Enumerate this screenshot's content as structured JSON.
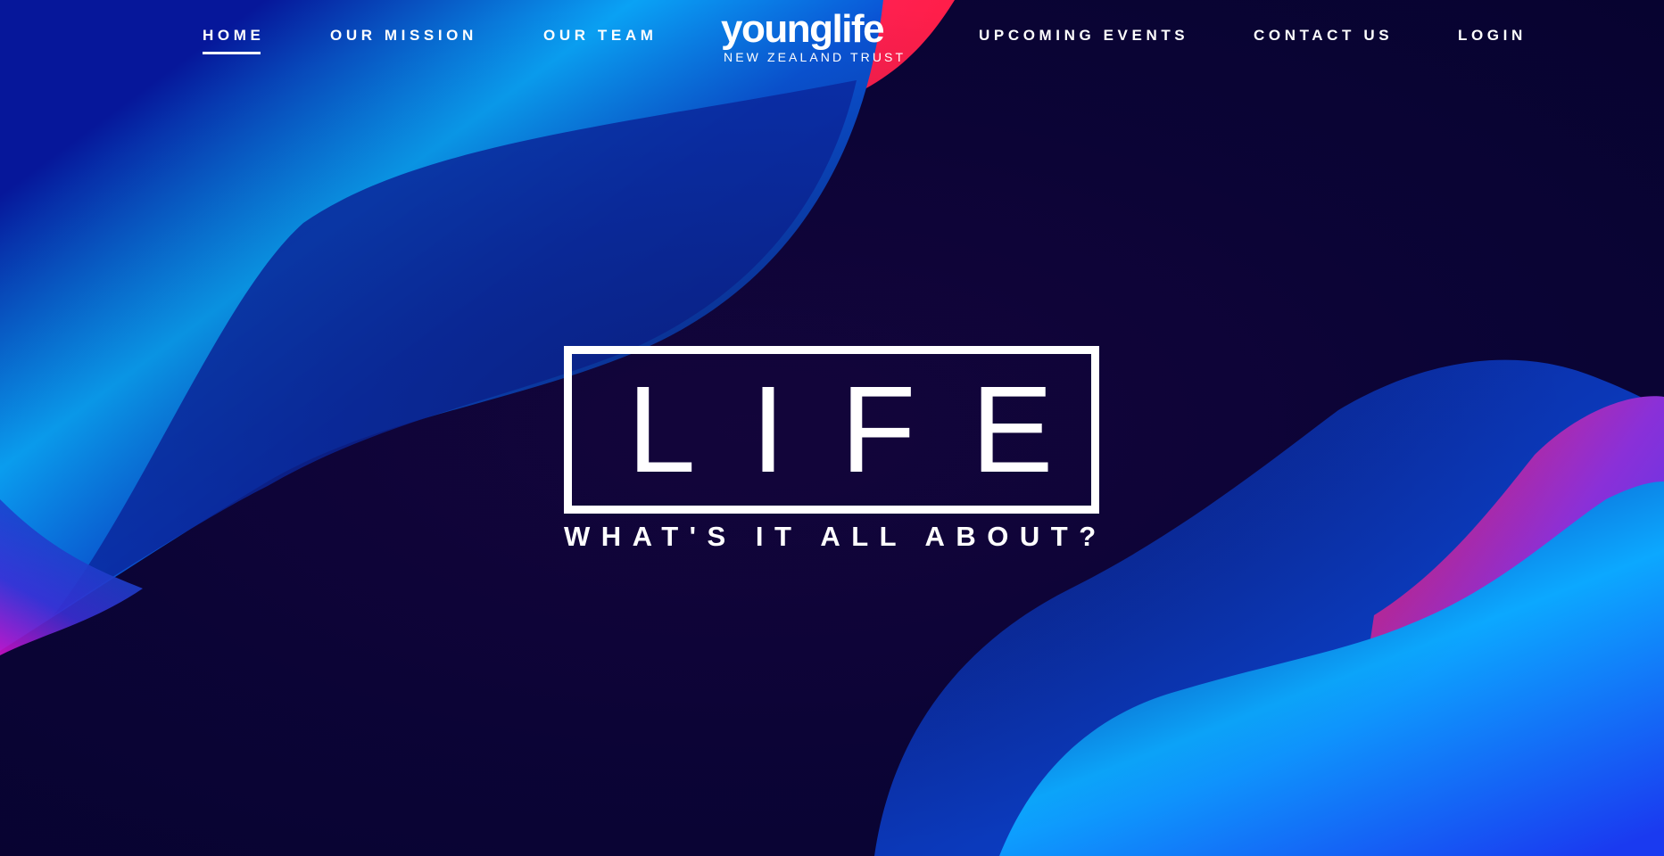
{
  "nav": {
    "items": [
      {
        "label": "HOME",
        "active": true
      },
      {
        "label": "OUR MISSION",
        "active": false
      },
      {
        "label": "OUR TEAM",
        "active": false
      },
      {
        "label": "UPCOMING EVENTS",
        "active": false
      },
      {
        "label": "CONTACT US",
        "active": false
      },
      {
        "label": "LOGIN",
        "active": false
      }
    ]
  },
  "logo": {
    "name": "younglife",
    "subtitle": "NEW ZEALAND TRUST"
  },
  "hero": {
    "title": "LIFE",
    "subtitle": "WHAT'S IT ALL ABOUT?"
  },
  "colors": {
    "background": "#0b0436",
    "text": "#ffffff",
    "accent_blue": "#00a8ff",
    "accent_red": "#ff1f4a",
    "accent_magenta": "#c010c0"
  }
}
